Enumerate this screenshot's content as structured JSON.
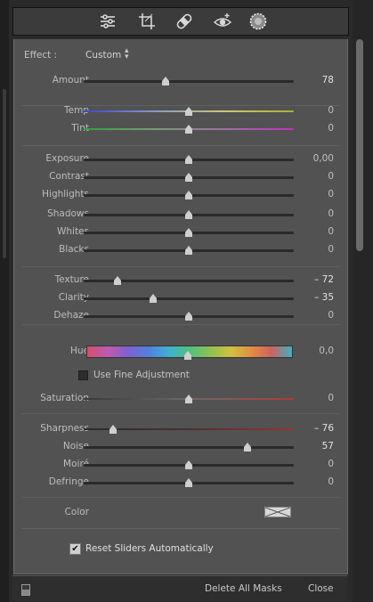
{
  "toolbar": {
    "tools": [
      "sliders-icon",
      "crop-icon",
      "healing-bandage-icon",
      "red-eye-icon",
      "masking-icon"
    ]
  },
  "effect": {
    "label": "Effect :",
    "value": "Custom"
  },
  "groups": [
    {
      "sliders": [
        {
          "label": "Amount",
          "value": "78",
          "percent": 39
        }
      ]
    },
    {
      "sliders": [
        {
          "label": "Temp",
          "value": "0",
          "percent": 50,
          "track": "temp"
        },
        {
          "label": "Tint",
          "value": "0",
          "percent": 50,
          "track": "tint"
        }
      ]
    },
    {
      "sliders": [
        {
          "label": "Exposure",
          "value": "0,00",
          "percent": 50
        },
        {
          "label": "Contrast",
          "value": "0",
          "percent": 50
        },
        {
          "label": "Highlights",
          "value": "0",
          "percent": 50
        },
        {
          "label": "Shadows",
          "value": "0",
          "percent": 50
        },
        {
          "label": "Whites",
          "value": "0",
          "percent": 50
        },
        {
          "label": "Blacks",
          "value": "0",
          "percent": 50
        }
      ]
    },
    {
      "sliders": [
        {
          "label": "Texture",
          "value": "– 72",
          "percent": 16
        },
        {
          "label": "Clarity",
          "value": "– 35",
          "percent": 33
        },
        {
          "label": "Dehaze",
          "value": "0",
          "percent": 50
        }
      ]
    }
  ],
  "hue": {
    "label": "Hue",
    "value": "0,0",
    "percent": 50
  },
  "fine_adjustment": {
    "label": "Use Fine Adjustment",
    "checked": false
  },
  "saturation": {
    "label": "Saturation",
    "value": "0",
    "percent": 50
  },
  "detail": [
    {
      "label": "Sharpness",
      "value": "– 76",
      "percent": 14,
      "track": "sharp"
    },
    {
      "label": "Noise",
      "value": "57",
      "percent": 78
    },
    {
      "label": "Moiré",
      "value": "0",
      "percent": 50
    },
    {
      "label": "Defringe",
      "value": "0",
      "percent": 50
    }
  ],
  "color": {
    "label": "Color"
  },
  "reset": {
    "label": "Reset Sliders Automatically",
    "checked": true
  },
  "footer": {
    "delete_label": "Delete All Masks",
    "close_label": "Close"
  },
  "colors": {
    "panel": "#525252",
    "track": "#2a2a2a"
  }
}
